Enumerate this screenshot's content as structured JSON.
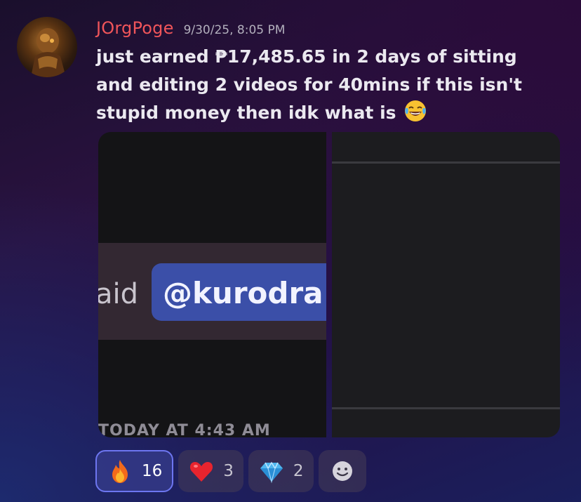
{
  "message": {
    "username": "JOrgPoge",
    "timestamp": "9/30/25, 8:05 PM",
    "text": "just earned ₱17,485.65 in 2 days of sitting and editing 2 videos for 40mins if this isn't stupid money then idk what is",
    "text_emoji": "face-with-tears-of-joy-icon"
  },
  "attachments": {
    "left_image": {
      "partial_text": "aid",
      "mention": "@kurodra",
      "footer": "TODAY AT 4:43 AM"
    }
  },
  "reactions": [
    {
      "icon": "fire-icon",
      "count": "16",
      "active": true
    },
    {
      "icon": "red-heart-icon",
      "count": "3",
      "active": false
    },
    {
      "icon": "gem-icon",
      "count": "2",
      "active": false
    },
    {
      "icon": "add-reaction-icon",
      "count": "",
      "active": false
    }
  ],
  "colors": {
    "username": "#f0555a",
    "mention_bg": "#3b4fa8",
    "active_reaction_border": "#6d76f0"
  }
}
